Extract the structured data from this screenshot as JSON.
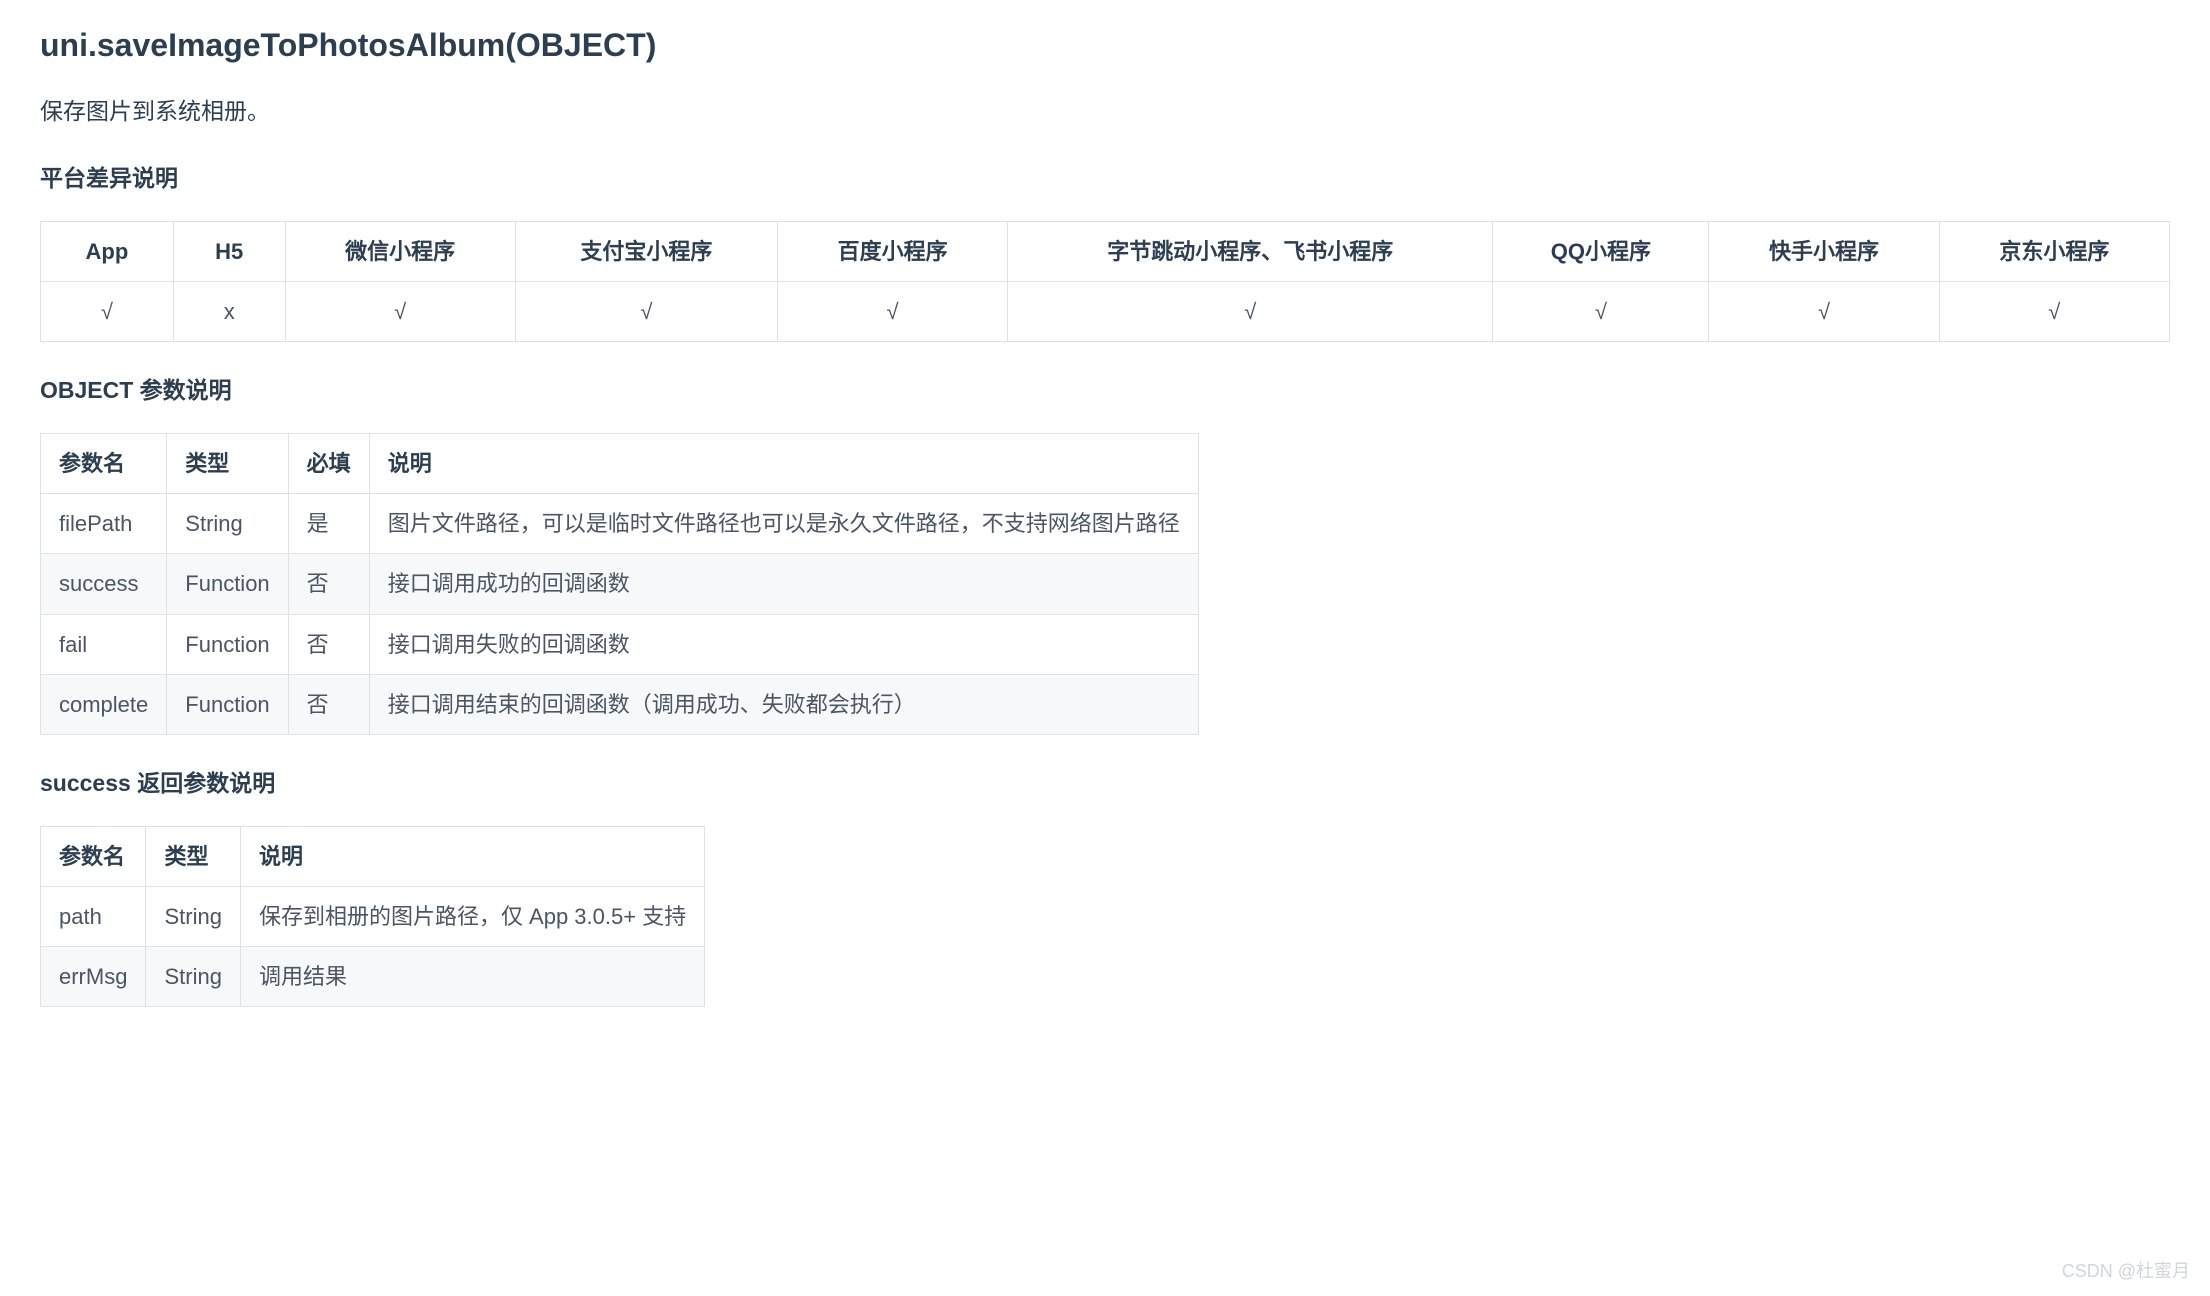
{
  "api": {
    "title": "uni.saveImageToPhotosAlbum(OBJECT)",
    "description": "保存图片到系统相册。"
  },
  "sections": {
    "platform_diff_title": "平台差异说明",
    "object_params_title": "OBJECT 参数说明",
    "success_return_title": "success 返回参数说明"
  },
  "platform_table": {
    "headers": [
      "App",
      "H5",
      "微信小程序",
      "支付宝小程序",
      "百度小程序",
      "字节跳动小程序、飞书小程序",
      "QQ小程序",
      "快手小程序",
      "京东小程序"
    ],
    "rows": [
      [
        "√",
        "x",
        "√",
        "√",
        "√",
        "√",
        "√",
        "√",
        "√"
      ]
    ]
  },
  "object_params_table": {
    "headers": [
      "参数名",
      "类型",
      "必填",
      "说明"
    ],
    "rows": [
      [
        "filePath",
        "String",
        "是",
        "图片文件路径，可以是临时文件路径也可以是永久文件路径，不支持网络图片路径"
      ],
      [
        "success",
        "Function",
        "否",
        "接口调用成功的回调函数"
      ],
      [
        "fail",
        "Function",
        "否",
        "接口调用失败的回调函数"
      ],
      [
        "complete",
        "Function",
        "否",
        "接口调用结束的回调函数（调用成功、失败都会执行）"
      ]
    ]
  },
  "success_return_table": {
    "headers": [
      "参数名",
      "类型",
      "说明"
    ],
    "rows": [
      [
        "path",
        "String",
        "保存到相册的图片路径，仅 App 3.0.5+ 支持"
      ],
      [
        "errMsg",
        "String",
        "调用结果"
      ]
    ]
  },
  "watermark": "CSDN @杜蜜月"
}
